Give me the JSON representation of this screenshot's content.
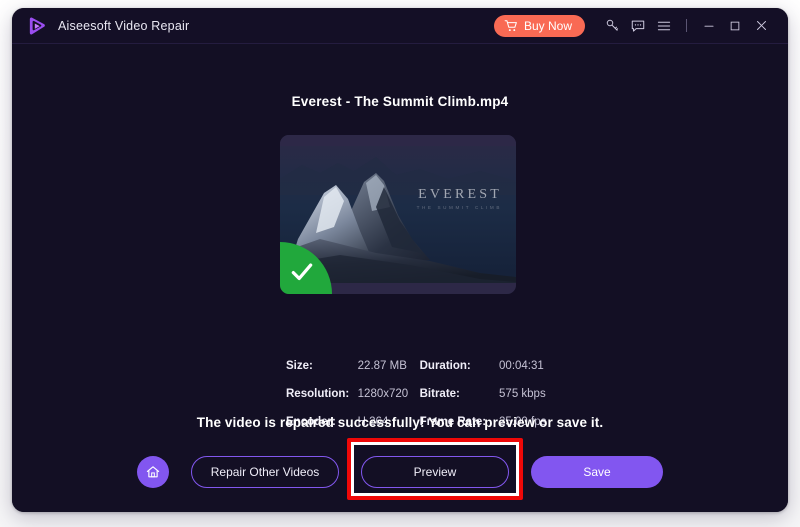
{
  "window": {
    "app_title": "Aiseesoft Video Repair",
    "logo_icon": "play-logo-icon",
    "accent_purple": "#8256f0",
    "buy_now_color": "#f96a54",
    "background": "#130f24",
    "success_green": "#21a83c",
    "annotation_color": "#ef0808"
  },
  "titlebar": {
    "buy_now_label": "Buy Now",
    "cart_icon": "shopping-cart-icon",
    "key_icon": "key-icon",
    "feedback_icon": "feedback-chat-icon",
    "menu_icon": "hamburger-menu-icon",
    "minimize_icon": "minimize-icon",
    "maximize_icon": "maximize-icon",
    "close_icon": "close-icon"
  },
  "main": {
    "file_name": "Everest - The Summit Climb.mp4",
    "thumbnail": {
      "overlay_title": "EVEREST",
      "overlay_subtitle": "THE SUMMIT CLIMB",
      "badge_icon": "checkmark-icon"
    },
    "success_message": "The video is repaired successfully! You can preview or save it."
  },
  "metadata": {
    "rows": [
      {
        "label_left": "Size:",
        "value_left": "22.87 MB",
        "label_right": "Duration:",
        "value_right": "00:04:31"
      },
      {
        "label_left": "Resolution:",
        "value_left": "1280x720",
        "label_right": "Bitrate:",
        "value_right": "575 kbps"
      },
      {
        "label_left": "Encoder:",
        "value_left": "H.264",
        "label_right": "Frame Rate:",
        "value_right": "25.00 fps"
      }
    ]
  },
  "actions": {
    "home_icon": "home-icon",
    "repair_other_label": "Repair Other Videos",
    "preview_label": "Preview",
    "save_label": "Save"
  }
}
